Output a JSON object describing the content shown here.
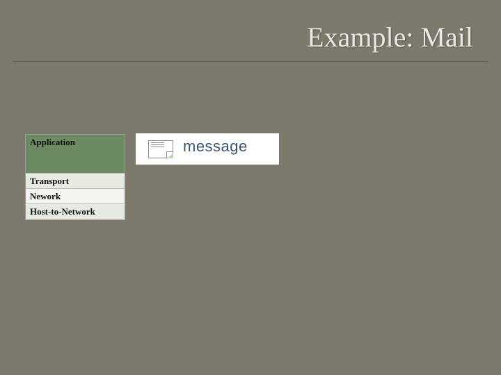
{
  "title": "Example: Mail",
  "layers": {
    "application": "Application",
    "transport": "Transport",
    "network": "Nework",
    "host": "Host-to-Network"
  },
  "message_label": "message"
}
